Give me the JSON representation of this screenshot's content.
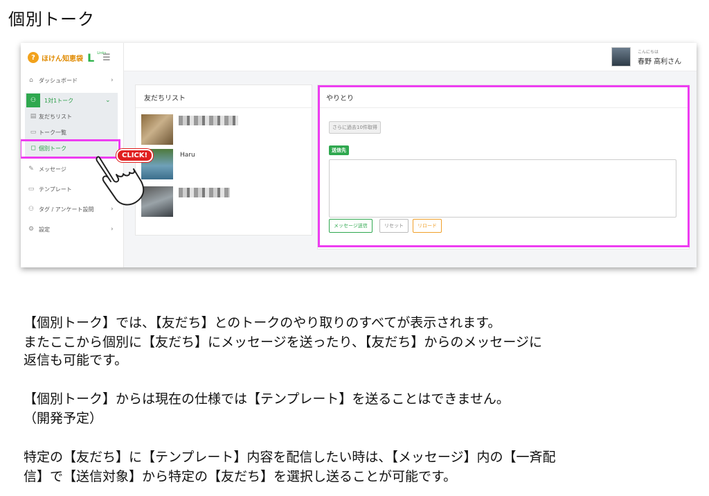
{
  "page_title": "個別トーク",
  "app": {
    "brand_name": "ほけん知恵袋",
    "brand_l": "L",
    "brand_sub": "Links",
    "menu_icon": "hamburger-icon",
    "sidebar": {
      "dashboard": "ダッシュボード",
      "talk_group": "1対1トーク",
      "friends_list": "友だちリスト",
      "talk_list": "トーク一覧",
      "individual_talk": "個別トーク",
      "message": "メッセージ",
      "template": "テンプレート",
      "tag_survey": "タグ / アンケート設問",
      "settings": "設定"
    },
    "header": {
      "greeting": "こんにちは",
      "user_name": "春野 高利さん"
    },
    "friends_card": {
      "title": "友だちリスト",
      "friends": [
        {
          "name": ""
        },
        {
          "name": "Haru"
        },
        {
          "name": ""
        }
      ]
    },
    "exchange_card": {
      "title": "やりとり",
      "load_more": "さらに過去10件取得",
      "to_badge": "送信先",
      "send_button": "メッセージ送信",
      "reset_button": "リセット",
      "reload_button": "リロード"
    },
    "click_badge": "CLICK!"
  },
  "colors": {
    "highlight": "#ee3df1",
    "accent_green": "#2fa84f",
    "reload_orange": "#f0a02a",
    "click_red": "#e02020"
  },
  "body_text": {
    "para1_line1": "【個別トーク】では、【友だち】とのトークのやり取りのすべてが表示されます。",
    "para1_line2": "またここから個別に【友だち】にメッセージを送ったり、【友だち】からのメッセージに",
    "para1_line3": "返信も可能です。",
    "para2_line1": "【個別トーク】からは現在の仕様では【テンプレート】を送ることはできません。",
    "para2_line2": "（開発予定）",
    "para3_line1": "特定の【友だち】に【テンプレート】内容を配信したい時は、【メッセージ】内の【一斉配",
    "para3_line2": "信】で【送信対象】から特定の【友だち】を選択し送ることが可能です。"
  }
}
